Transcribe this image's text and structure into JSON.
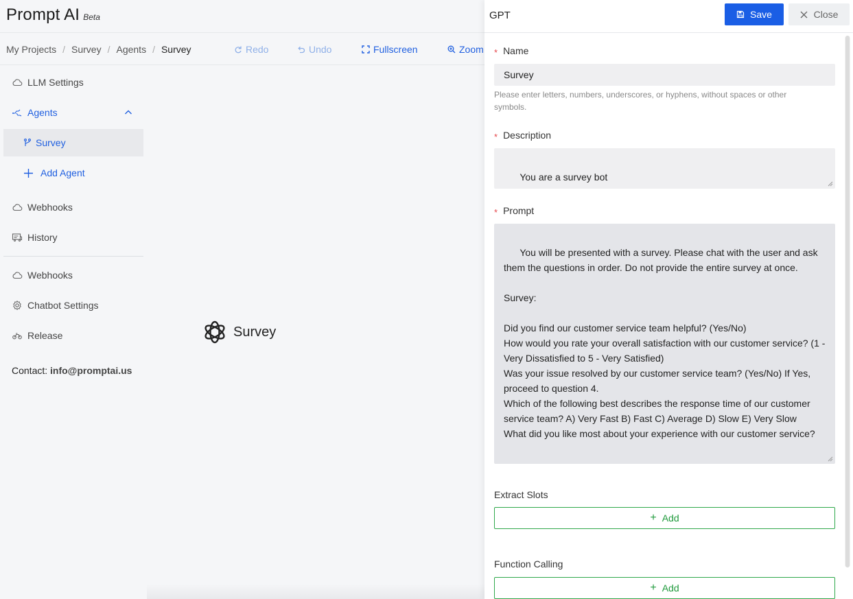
{
  "app": {
    "name": "Prompt AI",
    "badge": "Beta"
  },
  "breadcrumb": [
    "My Projects",
    "Survey",
    "Agents",
    "Survey"
  ],
  "toolbar": {
    "redo": "Redo",
    "undo": "Undo",
    "fullscreen": "Fullscreen",
    "zoom": "Zoom"
  },
  "sidebar": {
    "items": [
      {
        "label": "LLM Settings",
        "icon": "cloud-icon"
      },
      {
        "label": "Agents",
        "icon": "agents-icon"
      },
      {
        "label": "Survey",
        "icon": "branch-icon"
      },
      {
        "label": "Add Agent",
        "icon": "plus-icon"
      },
      {
        "label": "Webhooks",
        "icon": "cloud-icon"
      },
      {
        "label": "History",
        "icon": "history-icon"
      },
      {
        "label": "Webhooks",
        "icon": "cloud-icon"
      },
      {
        "label": "Chatbot Settings",
        "icon": "gear-icon"
      },
      {
        "label": "Release",
        "icon": "release-icon"
      }
    ],
    "contact_label": "Contact:",
    "contact_email": "info@promptai.us"
  },
  "canvas": {
    "node_label": "Survey",
    "node_icon": "openai-icon"
  },
  "panel": {
    "title": "GPT",
    "save": "Save",
    "close": "Close",
    "name_label": "Name",
    "name_value": "Survey",
    "name_hint": "Please enter letters, numbers, underscores, or hyphens, without spaces or other symbols.",
    "description_label": "Description",
    "description_value": "You are a survey bot",
    "prompt_label": "Prompt",
    "prompt_value": "You will be presented with a survey. Please chat with the user and ask them the questions in order. Do not provide the entire survey at once.\n\nSurvey:\n\nDid you find our customer service team helpful? (Yes/No)\nHow would you rate your overall satisfaction with our customer service? (1 - Very Dissatisfied to 5 - Very Satisfied)\nWas your issue resolved by our customer service team? (Yes/No) If Yes, proceed to question 4.\nWhich of the following best describes the response time of our customer service team? A) Very Fast B) Fast C) Average D) Slow E) Very Slow\nWhat did you like most about your experience with our customer service?",
    "extract_slots_label": "Extract Slots",
    "function_calling_label": "Function Calling",
    "add_label": "Add"
  },
  "colors": {
    "accent": "#1a5ee5",
    "success": "#2fa84a",
    "required": "#e5484d"
  }
}
